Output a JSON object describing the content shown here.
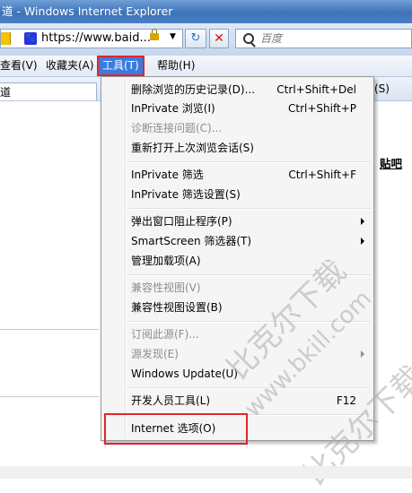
{
  "window": {
    "title": "道 - Windows Internet Explorer"
  },
  "address_bar": {
    "url": "https://www.baid...",
    "search_placeholder": "百度"
  },
  "menu_bar": {
    "items": [
      "查看(V)",
      "收藏夹(A)",
      "工具(T)",
      "帮助(H)"
    ],
    "active": "工具(T)"
  },
  "toolbar": {
    "page_tab": "道",
    "safety": "(S)"
  },
  "content": {
    "link": "贴吧"
  },
  "tools_menu": {
    "delete_history": {
      "label": "删除浏览的历史记录(D)...",
      "shortcut": "Ctrl+Shift+Del"
    },
    "inprivate_browse": {
      "label": "InPrivate 浏览(I)",
      "shortcut": "Ctrl+Shift+P"
    },
    "diagnose": {
      "label": "诊断连接问题(C)..."
    },
    "reopen_session": {
      "label": "重新打开上次浏览会话(S)"
    },
    "inprivate_filter": {
      "label": "InPrivate 筛选",
      "shortcut": "Ctrl+Shift+F"
    },
    "inprivate_filter_settings": {
      "label": "InPrivate 筛选设置(S)"
    },
    "popup_blocker": {
      "label": "弹出窗口阻止程序(P)"
    },
    "smartscreen": {
      "label": "SmartScreen 筛选器(T)"
    },
    "manage_addons": {
      "label": "管理加载项(A)"
    },
    "compat_view": {
      "label": "兼容性视图(V)"
    },
    "compat_view_settings": {
      "label": "兼容性视图设置(B)"
    },
    "subscribe": {
      "label": "订阅此源(F)..."
    },
    "feed_discovery": {
      "label": "源发现(E)"
    },
    "windows_update": {
      "label": "Windows Update(U)"
    },
    "dev_tools": {
      "label": "开发人员工具(L)",
      "shortcut": "F12"
    },
    "internet_options": {
      "label": "Internet 选项(O)"
    }
  },
  "watermark": {
    "line1": "比克尔下载",
    "line2": "www.bkill.com"
  },
  "colors": {
    "highlight_red": "#e0262a",
    "menu_active": "#3a7be0"
  }
}
